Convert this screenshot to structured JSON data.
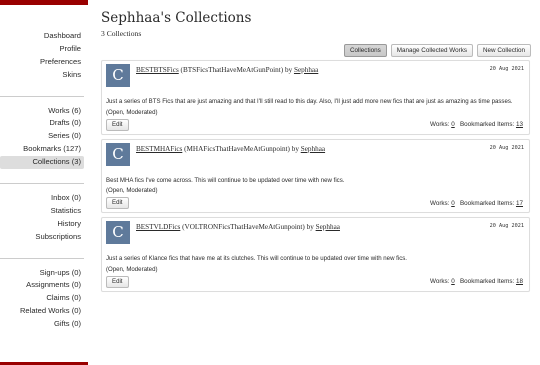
{
  "sidebar": {
    "group1": [
      "Dashboard",
      "Profile",
      "Preferences",
      "Skins"
    ],
    "group2": [
      "Works (6)",
      "Drafts (0)",
      "Series (0)",
      "Bookmarks (127)",
      "Collections (3)"
    ],
    "group3": [
      "Inbox (0)",
      "Statistics",
      "History",
      "Subscriptions"
    ],
    "group4": [
      "Sign-ups (0)",
      "Assignments (0)",
      "Claims (0)",
      "Related Works (0)",
      "Gifts (0)"
    ],
    "current": "Collections (3)"
  },
  "page": {
    "title": "Sephhaa's Collections",
    "count": "3 Collections"
  },
  "actions": {
    "collections": "Collections",
    "manage": "Manage Collected Works",
    "new": "New Collection"
  },
  "labels": {
    "by": "by",
    "edit": "Edit",
    "works": "Works:",
    "bookmarked": "Bookmarked Items:"
  },
  "collections": [
    {
      "avatar": "C",
      "name": "BESTBTSFics",
      "handle": "(BTSFicsThatHaveMeAtGunPoint)",
      "owner": "Sephhaa",
      "date": "20 Aug 2021",
      "description": "Just a series of BTS Fics that are just amazing and that I'll still read to this day. Also, I'll just add more new fics that are just as amazing as time passes.",
      "status": "(Open, Moderated)",
      "works": "0",
      "bookmarked": "13"
    },
    {
      "avatar": "C",
      "name": "BESTMHAFics",
      "handle": "(MHAFicsThatHaveMeAtGunpoint)",
      "owner": "Sephhaa",
      "date": "20 Aug 2021",
      "description": "Best MHA fics I've come across. This will continue to be updated over time with new fics.",
      "status": "(Open, Moderated)",
      "works": "0",
      "bookmarked": "17"
    },
    {
      "avatar": "C",
      "name": "BESTVLDFics",
      "handle": "(VOLTRONFicsThatHaveMeAtGunpoint)",
      "owner": "Sephhaa",
      "date": "20 Aug 2021",
      "description": "Just a series of Klance fics that have me at its clutches. This will continue to be updated over time with new fics.",
      "status": "(Open, Moderated)",
      "works": "0",
      "bookmarked": "18"
    }
  ],
  "colors": {
    "accent": "#990000",
    "avatar": "#5f7a9b"
  }
}
